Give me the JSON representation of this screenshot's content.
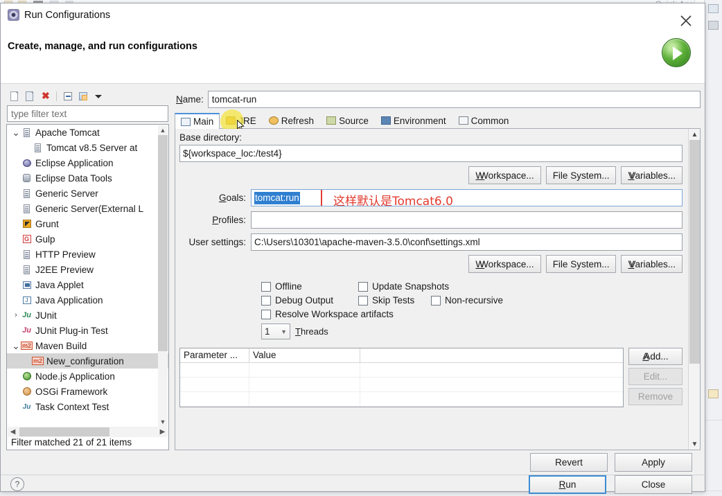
{
  "background": {
    "quick_access_text": "Quick Access",
    "toolbar_icons": [
      "folder-icon",
      "folder-icon",
      "terminal-icon",
      "debug-icon",
      "server-icon"
    ],
    "rail_icons": [
      "grid-icon",
      "bug-icon",
      "folder-icon"
    ]
  },
  "dialog": {
    "title": "Run Configurations",
    "app_icon": "run-configurations-icon",
    "subtitle": "Create, manage, and run configurations",
    "close_icon": "close-icon",
    "header_icon": "run-green-icon"
  },
  "tree_toolbar": {
    "buttons": [
      {
        "name": "new-configuration-button",
        "icon": "new-document-icon"
      },
      {
        "name": "duplicate-configuration-button",
        "icon": "duplicate-document-icon"
      },
      {
        "name": "delete-configuration-button",
        "icon": "delete-x-icon",
        "glyph": "✖"
      },
      {
        "name": "collapse-all-button",
        "icon": "collapse-all-icon"
      },
      {
        "name": "link-with-editor-button",
        "icon": "link-filter-icon"
      },
      {
        "name": "view-menu-button",
        "icon": "chevron-down-icon"
      }
    ]
  },
  "filter": {
    "placeholder": "type filter text",
    "value": "",
    "status": "Filter matched 21 of 21 items"
  },
  "tree": {
    "items": [
      {
        "label": "Apache Tomcat",
        "icon": "server-icon",
        "indent": 0,
        "twisty": "expanded",
        "selected": false
      },
      {
        "label": "Tomcat v8.5 Server at",
        "icon": "server-icon",
        "indent": 1,
        "twisty": "none",
        "selected": false
      },
      {
        "label": "Eclipse Application",
        "icon": "eclipse-icon",
        "indent": 0,
        "twisty": "none",
        "selected": false
      },
      {
        "label": "Eclipse Data Tools",
        "icon": "database-icon",
        "indent": 0,
        "twisty": "none",
        "selected": false
      },
      {
        "label": "Generic Server",
        "icon": "server-icon",
        "indent": 0,
        "twisty": "none",
        "selected": false
      },
      {
        "label": "Generic Server(External L",
        "icon": "server-icon",
        "indent": 0,
        "twisty": "none",
        "selected": false
      },
      {
        "label": "Grunt",
        "icon": "grunt-icon",
        "indent": 0,
        "twisty": "none",
        "selected": false
      },
      {
        "label": "Gulp",
        "icon": "gulp-icon",
        "indent": 0,
        "twisty": "none",
        "selected": false
      },
      {
        "label": "HTTP Preview",
        "icon": "server-icon",
        "indent": 0,
        "twisty": "none",
        "selected": false
      },
      {
        "label": "J2EE Preview",
        "icon": "server-icon",
        "indent": 0,
        "twisty": "none",
        "selected": false
      },
      {
        "label": "Java Applet",
        "icon": "java-applet-icon",
        "indent": 0,
        "twisty": "none",
        "selected": false
      },
      {
        "label": "Java Application",
        "icon": "java-app-icon",
        "indent": 0,
        "twisty": "none",
        "selected": false
      },
      {
        "label": "JUnit",
        "icon": "junit-icon",
        "indent": 0,
        "twisty": "collapsed",
        "selected": false
      },
      {
        "label": "JUnit Plug-in Test",
        "icon": "junit-plugin-icon",
        "indent": 0,
        "twisty": "none",
        "selected": false
      },
      {
        "label": "Maven Build",
        "icon": "maven-icon",
        "indent": 0,
        "twisty": "expanded",
        "selected": false
      },
      {
        "label": "New_configuration",
        "icon": "maven-icon",
        "indent": 1,
        "twisty": "none",
        "selected": true
      },
      {
        "label": "Node.js Application",
        "icon": "nodejs-icon",
        "indent": 0,
        "twisty": "none",
        "selected": false
      },
      {
        "label": "OSGi Framework",
        "icon": "osgi-icon",
        "indent": 0,
        "twisty": "none",
        "selected": false
      },
      {
        "label": "Task Context Test",
        "icon": "task-context-icon",
        "indent": 0,
        "twisty": "none",
        "selected": false
      }
    ]
  },
  "config": {
    "name_label": "Name:",
    "name_value": "tomcat-run",
    "tabs": [
      {
        "label": "Main",
        "icon": "main-tab-icon",
        "active": true
      },
      {
        "label": "JRE",
        "icon": "jre-tab-icon",
        "active": false
      },
      {
        "label": "Refresh",
        "icon": "refresh-tab-icon",
        "active": false
      },
      {
        "label": "Source",
        "icon": "source-tab-icon",
        "active": false
      },
      {
        "label": "Environment",
        "icon": "environment-tab-icon",
        "active": false
      },
      {
        "label": "Common",
        "icon": "common-tab-icon",
        "active": false
      }
    ],
    "cursor_on_tab": "JRE",
    "base_directory_label": "Base directory:",
    "base_directory_value": "${workspace_loc:/test4}",
    "browse_buttons_top": [
      {
        "label": "Workspace...",
        "mnemonic": "W"
      },
      {
        "label": "File System...",
        "mnemonic": "m"
      },
      {
        "label": "Variables...",
        "mnemonic": "V"
      }
    ],
    "goals_label": "Goals:",
    "goals_value": "tomcat:run",
    "goals_selected": true,
    "goals_annotation": "这样默认是Tomcat6.0",
    "annotation_color": "#e23a2e",
    "highlight_color": "#f4e53a",
    "profiles_label": "Profiles:",
    "profiles_value": "",
    "user_settings_label": "User settings:",
    "user_settings_value": "C:\\Users\\10301\\apache-maven-3.5.0\\conf\\settings.xml",
    "browse_buttons_bottom": [
      {
        "label": "Workspace...",
        "mnemonic": "W"
      },
      {
        "label": "File System...",
        "mnemonic": "m"
      },
      {
        "label": "Variables...",
        "mnemonic": "V"
      }
    ],
    "checkboxes": [
      [
        {
          "label": "Offline",
          "checked": false
        },
        {
          "label": "Update Snapshots",
          "checked": false
        }
      ],
      [
        {
          "label": "Debug Output",
          "checked": false
        },
        {
          "label": "Skip Tests",
          "checked": false
        },
        {
          "label": "Non-recursive",
          "checked": false
        }
      ],
      [
        {
          "label": "Resolve Workspace artifacts",
          "checked": false
        }
      ]
    ],
    "threads_value": "1",
    "threads_label": "Threads",
    "parameter_table": {
      "columns": [
        "Parameter ...",
        "Value",
        ""
      ],
      "rows": []
    },
    "parameter_buttons": [
      {
        "label": "Add...",
        "enabled": true
      },
      {
        "label": "Edit...",
        "enabled": false
      },
      {
        "label": "Remove",
        "enabled": false
      }
    ]
  },
  "footer": {
    "revert_label": "Revert",
    "apply_label": "Apply",
    "run_label": "Run",
    "close_label": "Close",
    "help_icon": "help-icon",
    "help_glyph": "?"
  }
}
